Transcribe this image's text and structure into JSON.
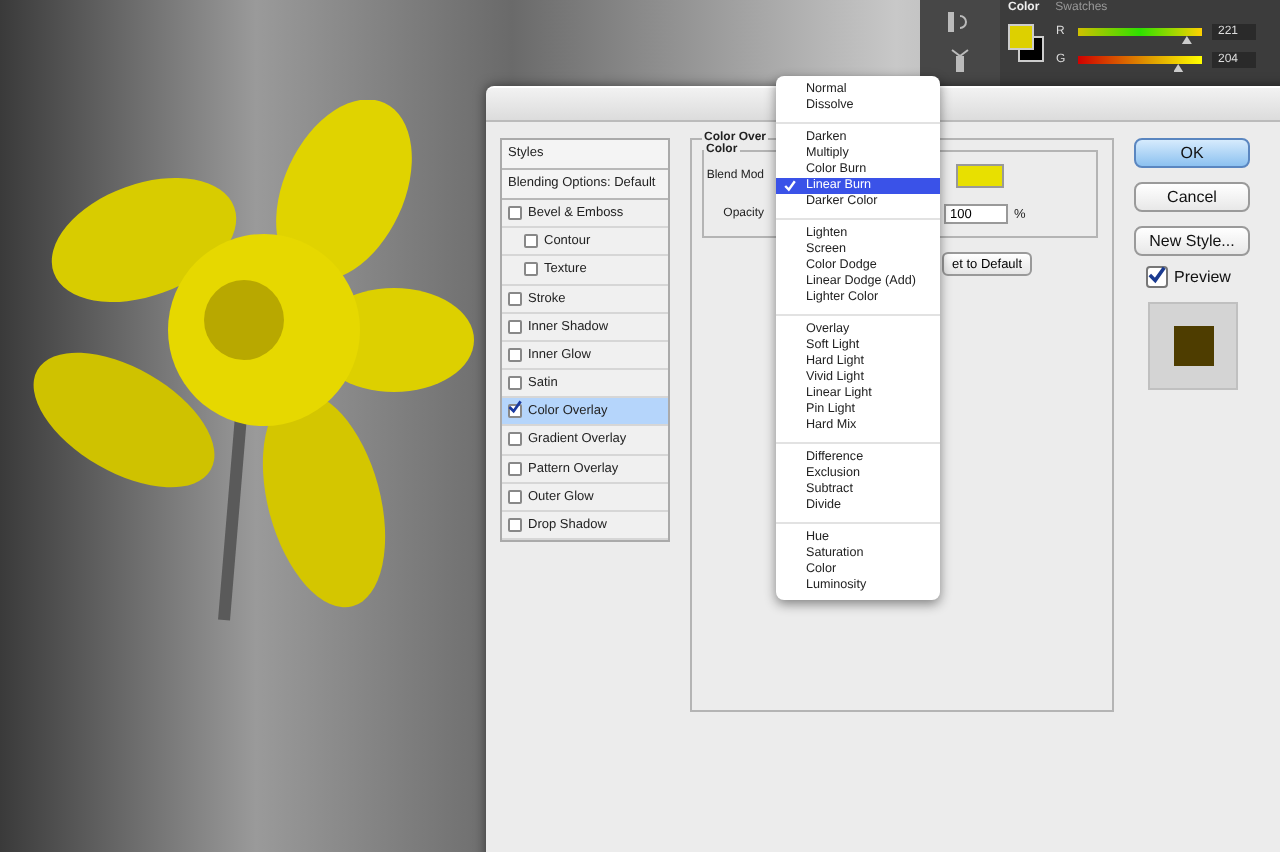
{
  "color_panel": {
    "tabs": [
      {
        "label": "Color",
        "selected": true
      },
      {
        "label": "Swatches",
        "selected": false
      }
    ],
    "channels": [
      {
        "label": "R",
        "value": "221",
        "level": 0.87
      },
      {
        "label": "G",
        "value": "204",
        "level": 0.8
      }
    ]
  },
  "styles_panel": {
    "header": "Styles",
    "blending_options": "Blending Options: Default",
    "effects": [
      {
        "label": "Bevel & Emboss",
        "checked": false,
        "selected": false,
        "children": [
          {
            "label": "Contour",
            "checked": false,
            "selected": false
          },
          {
            "label": "Texture",
            "checked": false,
            "selected": false
          }
        ]
      },
      {
        "label": "Stroke",
        "checked": false,
        "selected": false
      },
      {
        "label": "Inner Shadow",
        "checked": false,
        "selected": false
      },
      {
        "label": "Inner Glow",
        "checked": false,
        "selected": false
      },
      {
        "label": "Satin",
        "checked": false,
        "selected": false
      },
      {
        "label": "Color Overlay",
        "checked": true,
        "selected": true
      },
      {
        "label": "Gradient Overlay",
        "checked": false,
        "selected": false
      },
      {
        "label": "Pattern Overlay",
        "checked": false,
        "selected": false
      },
      {
        "label": "Outer Glow",
        "checked": false,
        "selected": false
      },
      {
        "label": "Drop Shadow",
        "checked": false,
        "selected": false
      }
    ]
  },
  "overlay_panel": {
    "title": "Color Over",
    "group_title": "Color",
    "blend_mode_label": "Blend Mod",
    "opacity_label": "Opacity",
    "opacity_value": "100",
    "opacity_unit": "%",
    "reset_button": "et to Default"
  },
  "buttons": [
    {
      "label": "OK",
      "default": true
    },
    {
      "label": "Cancel",
      "default": false
    },
    {
      "label": "New Style...",
      "default": false
    }
  ],
  "preview": {
    "label": "Preview",
    "checked": true
  },
  "blend_menu": {
    "groups": [
      {
        "items": [
          {
            "label": "Normal",
            "selected": false
          },
          {
            "label": "Dissolve",
            "selected": false
          }
        ]
      },
      {
        "items": [
          {
            "label": "Darken",
            "selected": false
          },
          {
            "label": "Multiply",
            "selected": false
          },
          {
            "label": "Color Burn",
            "selected": false
          },
          {
            "label": "Linear Burn",
            "selected": true
          },
          {
            "label": "Darker Color",
            "selected": false
          }
        ]
      },
      {
        "items": [
          {
            "label": "Lighten",
            "selected": false
          },
          {
            "label": "Screen",
            "selected": false
          },
          {
            "label": "Color Dodge",
            "selected": false
          },
          {
            "label": "Linear Dodge (Add)",
            "selected": false
          },
          {
            "label": "Lighter Color",
            "selected": false
          }
        ]
      },
      {
        "items": [
          {
            "label": "Overlay",
            "selected": false
          },
          {
            "label": "Soft Light",
            "selected": false
          },
          {
            "label": "Hard Light",
            "selected": false
          },
          {
            "label": "Vivid Light",
            "selected": false
          },
          {
            "label": "Linear Light",
            "selected": false
          },
          {
            "label": "Pin Light",
            "selected": false
          },
          {
            "label": "Hard Mix",
            "selected": false
          }
        ]
      },
      {
        "items": [
          {
            "label": "Difference",
            "selected": false
          },
          {
            "label": "Exclusion",
            "selected": false
          },
          {
            "label": "Subtract",
            "selected": false
          },
          {
            "label": "Divide",
            "selected": false
          }
        ]
      },
      {
        "items": [
          {
            "label": "Hue",
            "selected": false
          },
          {
            "label": "Saturation",
            "selected": false
          },
          {
            "label": "Color",
            "selected": false
          },
          {
            "label": "Luminosity",
            "selected": false
          }
        ]
      }
    ]
  }
}
